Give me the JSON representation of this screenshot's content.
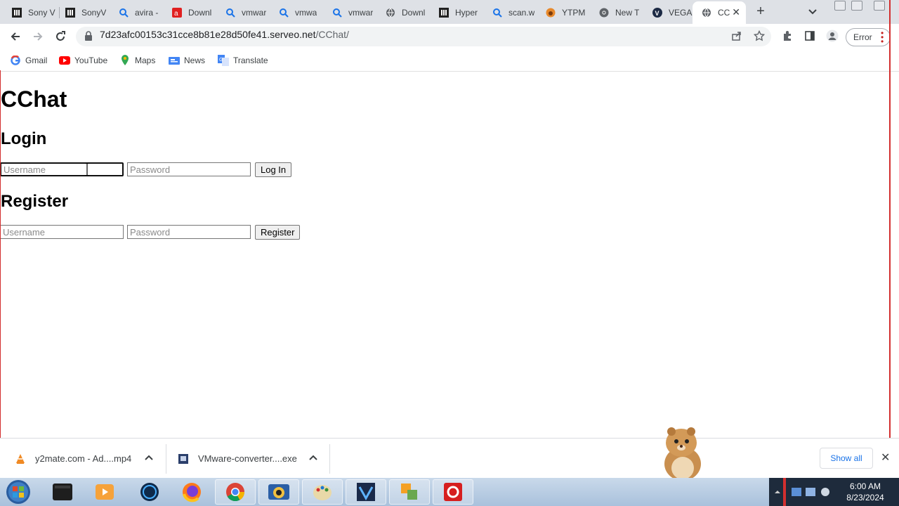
{
  "browser": {
    "tabs": [
      {
        "label": "Sony V",
        "icon": "library-icon"
      },
      {
        "label": "SonyV",
        "icon": "library-icon"
      },
      {
        "label": "avira -",
        "icon": "search-icon"
      },
      {
        "label": "Downl",
        "icon": "avira-icon"
      },
      {
        "label": "vmwar",
        "icon": "search-icon"
      },
      {
        "label": "vmwa",
        "icon": "search-icon"
      },
      {
        "label": "vmwar",
        "icon": "search-icon"
      },
      {
        "label": "Downl",
        "icon": "globe-icon"
      },
      {
        "label": "Hyper",
        "icon": "library-icon"
      },
      {
        "label": "scan.w",
        "icon": "search-icon"
      },
      {
        "label": "YTPM",
        "icon": "fox-icon"
      },
      {
        "label": "New T",
        "icon": "chrome-icon"
      },
      {
        "label": "VEGAS",
        "icon": "vegas-icon"
      },
      {
        "label": "CC",
        "icon": "globe-icon"
      }
    ],
    "active_tab_close": "✕",
    "new_tab": "+",
    "url_host": "7d23afc00153c31cce8b81e28d50fe41.serveo.net",
    "url_path": "/CChat/",
    "error_button": "Error",
    "bookmarks": [
      {
        "label": "Gmail",
        "icon": "google-icon"
      },
      {
        "label": "YouTube",
        "icon": "youtube-icon"
      },
      {
        "label": "Maps",
        "icon": "maps-icon"
      },
      {
        "label": "News",
        "icon": "news-icon"
      },
      {
        "label": "Translate",
        "icon": "translate-icon"
      }
    ]
  },
  "page": {
    "title": "CChat",
    "login": {
      "heading": "Login",
      "username_placeholder": "Username",
      "password_placeholder": "Password",
      "button": "Log In"
    },
    "register": {
      "heading": "Register",
      "username_placeholder": "Username",
      "password_placeholder": "Password",
      "button": "Register"
    }
  },
  "downloads": {
    "items": [
      {
        "label": "y2mate.com - Ad....mp4",
        "icon": "vlc-icon"
      },
      {
        "label": "VMware-converter....exe",
        "icon": "installer-icon"
      }
    ],
    "show_all": "Show all",
    "close": "✕"
  },
  "taskbar": {
    "time": "6:00 AM",
    "date": "8/23/2024"
  },
  "colors": {
    "tabstrip": "#dee1e6",
    "link_blue": "#1a73e8",
    "taskbar": "#b9cde3"
  }
}
